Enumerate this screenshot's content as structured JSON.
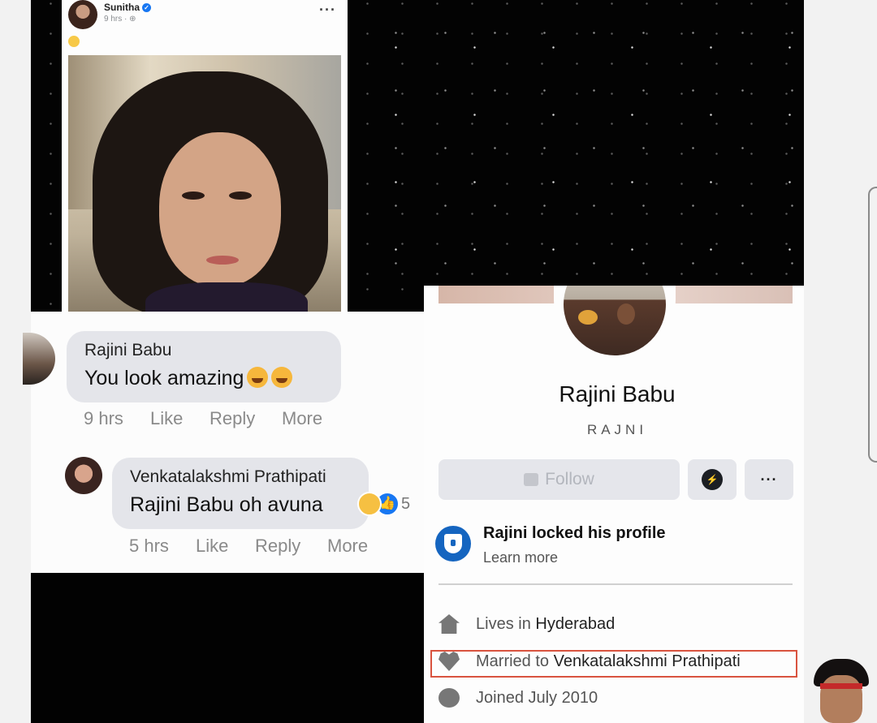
{
  "post": {
    "author": "Sunitha",
    "time": "9 hrs ·"
  },
  "comment1": {
    "author": "Rajini Babu",
    "text": "You look amazing",
    "time": "9 hrs",
    "like": "Like",
    "reply": "Reply",
    "more": "More"
  },
  "comment2": {
    "author": "Venkatalakshmi Prathipati",
    "text": "Rajini Babu oh avuna",
    "reaction_count": "5",
    "time": "5 hrs",
    "like": "Like",
    "reply": "Reply",
    "more": "More"
  },
  "profile": {
    "name": "Rajini Babu",
    "nickname": "RAJNI",
    "follow_label": "Follow",
    "locked_title": "Rajini locked his profile",
    "learn_more": "Learn more",
    "lives_prefix": "Lives in",
    "lives_value": "Hyderabad",
    "married_prefix": "Married to",
    "married_value": "Venkatalakshmi Prathipati",
    "joined": "Joined July 2010"
  },
  "colors": {
    "accent": "#1877f2",
    "highlight_border": "#d9533f"
  }
}
